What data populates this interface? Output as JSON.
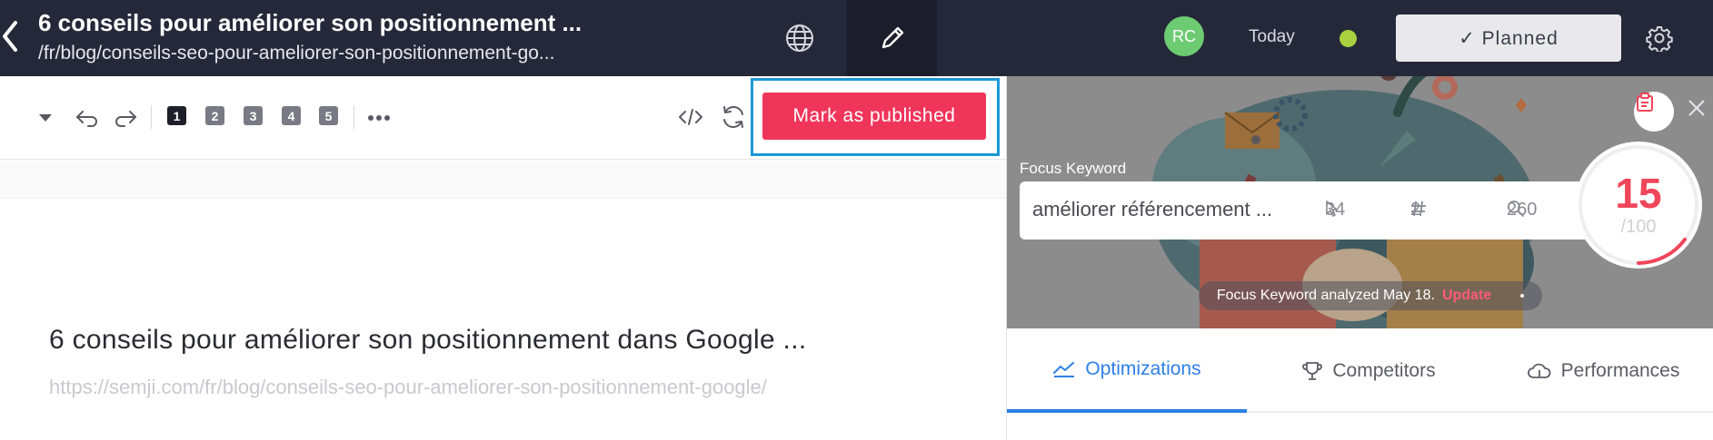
{
  "topbar": {
    "title": "6 conseils pour améliorer son positionnement ...",
    "subtitle": "/fr/blog/conseils-seo-pour-ameliorer-son-positionnement-go...",
    "avatar_initials": "RC",
    "due_date": "Today",
    "status_label": "✓ Planned",
    "status_dot_color": "#a9d13f"
  },
  "toolbar": {
    "heading_levels": [
      "1",
      "2",
      "3",
      "4",
      "5"
    ],
    "publish_label": "Mark as published",
    "publish_color": "#f0355b"
  },
  "editor": {
    "title": "6 conseils pour améliorer son positionnement dans Google ...",
    "url": "https://semji.com/fr/blog/conseils-seo-pour-ameliorer-son-positionnement-google/"
  },
  "panel": {
    "focus_keyword_label": "Focus Keyword",
    "focus_keyword_value": "améliorer référencement ...",
    "stats": {
      "clicks": "34",
      "position": "2",
      "searches": "260"
    },
    "score": "15",
    "score_max": "/100",
    "analysis_note": "Focus Keyword analyzed May 18.",
    "update_link": "Update",
    "tabs": [
      {
        "label": "Optimizations",
        "icon": "trend-up-icon",
        "active": true
      },
      {
        "label": "Competitors",
        "icon": "trophy-icon",
        "active": false
      },
      {
        "label": "Performances",
        "icon": "cloud-icon",
        "active": false
      }
    ]
  },
  "colors": {
    "topbar_bg": "#252838",
    "accent_blue": "#2d7fe6",
    "score_red": "#f0455a"
  }
}
